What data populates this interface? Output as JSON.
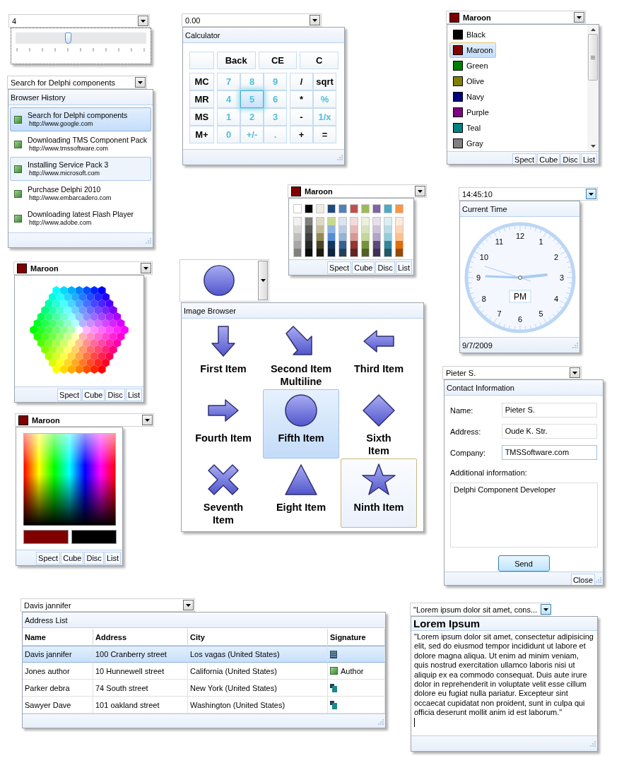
{
  "slider_picker": {
    "value": "4",
    "level": 0.4
  },
  "history_picker": {
    "value": "Search for Delphi components",
    "title": "Browser History",
    "items": [
      {
        "title": "Search for Delphi components",
        "url": "http://www.google.com",
        "selected": true,
        "hovered": false
      },
      {
        "title": "Downloading TMS Component Pack",
        "url": "http://www.tmssoftware.com",
        "selected": false,
        "hovered": false
      },
      {
        "title": "Installing Service Pack 3",
        "url": "http://www.microsoft.com",
        "selected": false,
        "hovered": true
      },
      {
        "title": "Purchase Delphi 2010",
        "url": "http://www.embarcadero.com",
        "selected": false,
        "hovered": false
      },
      {
        "title": "Downloading latest Flash Player",
        "url": "http://www.adobe.com",
        "selected": false,
        "hovered": false
      }
    ]
  },
  "calculator_picker": {
    "value": "0.00",
    "title": "Calculator",
    "edit_keys": [
      "Back",
      "CE",
      "C"
    ],
    "memory_keys": [
      "MC",
      "MR",
      "MS",
      "M+"
    ],
    "digit_keys": [
      {
        "label": "7",
        "selected": false
      },
      {
        "label": "8",
        "selected": false
      },
      {
        "label": "9",
        "selected": false
      },
      {
        "label": "4",
        "selected": false
      },
      {
        "label": "5",
        "selected": true
      },
      {
        "label": "6",
        "selected": false
      },
      {
        "label": "1",
        "selected": false
      },
      {
        "label": "2",
        "selected": false
      },
      {
        "label": "3",
        "selected": false
      },
      {
        "label": "0",
        "selected": false
      },
      {
        "label": "+/-",
        "selected": false
      },
      {
        "label": ".",
        "selected": false
      }
    ],
    "operator_keys": [
      {
        "label": "/",
        "kind": "operator"
      },
      {
        "label": "sqrt",
        "kind": "operator"
      },
      {
        "label": "*",
        "kind": "operator"
      },
      {
        "label": "%",
        "kind": "function"
      },
      {
        "label": "-",
        "kind": "operator"
      },
      {
        "label": "1/x",
        "kind": "function"
      },
      {
        "label": "+",
        "kind": "operator"
      },
      {
        "label": "=",
        "kind": "operator"
      }
    ]
  },
  "color_list_picker": {
    "value": "Maroon",
    "color": "#800000",
    "items": [
      {
        "name": "Black",
        "color": "#000000",
        "selected": false
      },
      {
        "name": "Maroon",
        "color": "#800000",
        "selected": true
      },
      {
        "name": "Green",
        "color": "#008000",
        "selected": false
      },
      {
        "name": "Olive",
        "color": "#808000",
        "selected": false
      },
      {
        "name": "Navy",
        "color": "#000080",
        "selected": false
      },
      {
        "name": "Purple",
        "color": "#800080",
        "selected": false
      },
      {
        "name": "Teal",
        "color": "#008080",
        "selected": false
      },
      {
        "name": "Gray",
        "color": "#808080",
        "selected": false
      }
    ],
    "modes": [
      "Spect",
      "Cube",
      "Disc",
      "List"
    ]
  },
  "palette_picker": {
    "value": "Maroon",
    "color": "#800000",
    "columns": [
      {
        "color": "#ffffff",
        "shades": [
          {
            "color": "#f2f2f2"
          },
          {
            "color": "#d9d9d9"
          },
          {
            "color": "#bfbfbf"
          },
          {
            "color": "#a6a6a6"
          },
          {
            "color": "#808080"
          }
        ]
      },
      {
        "color": "#000000",
        "shades": [
          {
            "color": "#7f7f7f"
          },
          {
            "color": "#595959"
          },
          {
            "color": "#3f3f3f"
          },
          {
            "color": "#262626"
          },
          {
            "color": "#0c0c0c"
          }
        ]
      },
      {
        "color": "#eeece1",
        "shades": [
          {
            "color": "#ddd9c3"
          },
          {
            "color": "#c4bd97"
          },
          {
            "color": "#938953"
          },
          {
            "color": "#494429"
          },
          {
            "color": "#1d1b10"
          }
        ]
      },
      {
        "color": "#1f497d",
        "shades": [
          {
            "color": "#c6d98e"
          },
          {
            "color": "#8db3e2"
          },
          {
            "color": "#548dd4"
          },
          {
            "color": "#17365d"
          },
          {
            "color": "#0f243e"
          }
        ]
      },
      {
        "color": "#4f81bd",
        "shades": [
          {
            "color": "#dbe5f1"
          },
          {
            "color": "#b8cce4"
          },
          {
            "color": "#95b3d7"
          },
          {
            "color": "#366092"
          },
          {
            "color": "#244061"
          }
        ]
      },
      {
        "color": "#c0504d",
        "shades": [
          {
            "color": "#f2dcdb"
          },
          {
            "color": "#e5b9b7"
          },
          {
            "color": "#d99694"
          },
          {
            "color": "#953734"
          },
          {
            "color": "#632423"
          }
        ]
      },
      {
        "color": "#9bbb59",
        "shades": [
          {
            "color": "#ebf1dd"
          },
          {
            "color": "#d7e3bc"
          },
          {
            "color": "#c3d69b"
          },
          {
            "color": "#76923c"
          },
          {
            "color": "#4f6128"
          }
        ]
      },
      {
        "color": "#8064a2",
        "shades": [
          {
            "color": "#e5e0ec"
          },
          {
            "color": "#ccc1d9"
          },
          {
            "color": "#b2a2c7"
          },
          {
            "color": "#5f497a"
          },
          {
            "color": "#3f3151"
          }
        ]
      },
      {
        "color": "#4bacc6",
        "shades": [
          {
            "color": "#dbeef3"
          },
          {
            "color": "#b7dde8"
          },
          {
            "color": "#92cddc"
          },
          {
            "color": "#31859b"
          },
          {
            "color": "#205867"
          }
        ]
      },
      {
        "color": "#f79646",
        "shades": [
          {
            "color": "#fdeada"
          },
          {
            "color": "#fbd5b5"
          },
          {
            "color": "#fac08f"
          },
          {
            "color": "#e36c09"
          },
          {
            "color": "#974806"
          }
        ]
      }
    ],
    "modes": [
      "Spect",
      "Cube",
      "Disc",
      "List"
    ]
  },
  "hexagon_picker": {
    "value": "Maroon",
    "color": "#800000",
    "modes": [
      "Spect",
      "Cube",
      "Disc",
      "List"
    ]
  },
  "spectrum_picker": {
    "value": "Maroon",
    "color": "#800000",
    "swatches": [
      {
        "color": "#800000"
      },
      {
        "color": "#000000"
      }
    ],
    "modes": [
      "Spect",
      "Cube",
      "Disc",
      "List"
    ]
  },
  "image_picker": {
    "title": "Image Browser",
    "items": [
      {
        "label": "First Item",
        "kind": "arrow-down",
        "selected": false,
        "hovered": false
      },
      {
        "label": "Second Item\nMultiline",
        "kind": "arrow-down-right",
        "selected": false,
        "hovered": false
      },
      {
        "label": "Third Item",
        "kind": "arrow-left",
        "selected": false,
        "hovered": false
      },
      {
        "label": "Fourth Item",
        "kind": "arrow-right",
        "selected": false,
        "hovered": false
      },
      {
        "label": "Fifth Item",
        "kind": "circle",
        "selected": true,
        "hovered": false
      },
      {
        "label": "Sixth\nItem",
        "kind": "diamond",
        "selected": false,
        "hovered": false
      },
      {
        "label": "Seventh\nItem",
        "kind": "cross",
        "selected": false,
        "hovered": false
      },
      {
        "label": "Eight Item",
        "kind": "triangle",
        "selected": false,
        "hovered": false
      },
      {
        "label": "Ninth Item",
        "kind": "star",
        "selected": false,
        "hovered": true
      }
    ]
  },
  "clock_picker": {
    "value": "14:45:10",
    "title": "Current Time",
    "numerals": [
      "12",
      "1",
      "2",
      "3",
      "4",
      "5",
      "6",
      "7",
      "8",
      "9",
      "10",
      "11"
    ],
    "period": "PM",
    "date": "9/7/2009"
  },
  "contact_picker": {
    "value": "Pieter S.",
    "title": "Contact Information",
    "fields": [
      {
        "label": "Name:",
        "value": "Pieter S.",
        "focused": false
      },
      {
        "label": "Address:",
        "value": "Oude K. Str.",
        "focused": false
      },
      {
        "label": "Company:",
        "value": "TMSSoftware.com",
        "focused": true
      }
    ],
    "notes_label": "Additional information:",
    "notes": "Delphi Component Developer",
    "send": "Send",
    "close": "Close"
  },
  "address_picker": {
    "value": "Davis jannifer",
    "title": "Address List",
    "columns": [
      "Name",
      "Address",
      "City",
      "Signature"
    ],
    "rows": [
      {
        "name": "Davis jannifer",
        "address": "100 Cranberry street",
        "city": "Los vagas (United States)",
        "signature": {
          "kind": "scan"
        },
        "selected": true
      },
      {
        "name": "Jones author",
        "address": "10 Hunnewell street",
        "city": "California (United States)",
        "signature": {
          "kind": "label",
          "text": "Author"
        },
        "selected": false
      },
      {
        "name": "Parker debra",
        "address": "74 South street",
        "city": "New York (United States)",
        "signature": {
          "kind": "stamp"
        },
        "selected": false
      },
      {
        "name": "Sawyer Dave",
        "address": "101 oakland street",
        "city": "Washington (United States)",
        "signature": {
          "kind": "stamp"
        },
        "selected": false
      }
    ]
  },
  "text_picker": {
    "value": "\"Lorem ipsum dolor sit amet, cons...",
    "title": "Lorem Ipsum",
    "body": "\"Lorem ipsum dolor sit amet, consectetur adipisicing elit, sed do eiusmod tempor incididunt ut labore et dolore magna aliqua. Ut enim ad minim veniam, quis nostrud exercitation ullamco laboris nisi ut aliquip ex ea commodo consequat. Duis aute irure dolor in reprehenderit in voluptate velit esse cillum dolore eu fugiat nulla pariatur. Excepteur sint occaecat cupidatat non proident, sunt in culpa qui officia deserunt mollit anim id est laborum.\""
  }
}
